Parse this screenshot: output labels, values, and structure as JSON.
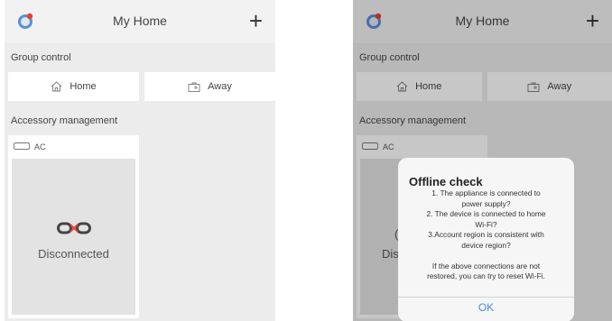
{
  "screen1": {
    "header": {
      "title": "My Home",
      "add_label": "+"
    },
    "group_control": {
      "section_title": "Group control",
      "home_label": "Home",
      "away_label": "Away"
    },
    "accessory": {
      "section_title": "Accessory management",
      "device_name": "AC",
      "status": "Disconnected"
    }
  },
  "screen2": {
    "header": {
      "title": "My Home",
      "add_label": "+"
    },
    "group_control": {
      "section_title": "Group control",
      "home_label": "Home",
      "away_label": "Away"
    },
    "accessory": {
      "section_title": "Accessory management",
      "device_name": "AC",
      "status_fragment_1": "Dis",
      "status_fragment_2": "("
    },
    "dialog": {
      "title": "Offline check",
      "lines": [
        "1. The appliance is connected to",
        "power supply?",
        "2. The device is connected to home",
        "Wi-Fi?",
        "3.Account region is consistent with",
        "device region?",
        "",
        "If the above connections are not",
        "restored, you can try to reset Wi-Fi."
      ],
      "ok_label": "OK"
    }
  },
  "colors": {
    "background": "#ececec",
    "card": "#ffffff",
    "accent": "#4a8ad8",
    "avatar_blue": "#5b8fd6",
    "avatar_red": "#e8412c"
  }
}
